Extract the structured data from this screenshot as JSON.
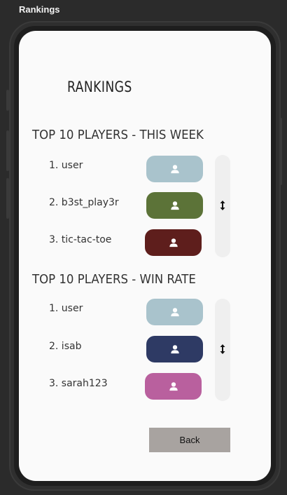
{
  "window": {
    "title": "Rankings"
  },
  "page": {
    "title": "RANKINGS"
  },
  "sections": [
    {
      "title": "TOP 10 PLAYERS - THIS WEEK",
      "players": [
        {
          "label": "1. user",
          "avatar_color": "#a9c3cc"
        },
        {
          "label": "2. b3st_play3r",
          "avatar_color": "#5c7338"
        },
        {
          "label": "3. tic-tac-toe",
          "avatar_color": "#5e1e1c"
        }
      ],
      "scroll_icon": "vertical-resize-arrows-icon"
    },
    {
      "title": "TOP 10 PLAYERS - WIN RATE",
      "players": [
        {
          "label": "1. user",
          "avatar_color": "#a9c3cc"
        },
        {
          "label": "2. isab",
          "avatar_color": "#2e3a64"
        },
        {
          "label": "3. sarah123",
          "avatar_color": "#b9609e"
        }
      ],
      "scroll_icon": "vertical-resize-arrows-icon"
    }
  ],
  "avatar_icon": "user-icon",
  "back_button": {
    "label": "Back",
    "color": "#a8a3a0"
  },
  "colors": {
    "screen_bg": "#fafafa",
    "frame_bg": "#2b2b2b",
    "scrollbar_bg": "#efefef"
  }
}
